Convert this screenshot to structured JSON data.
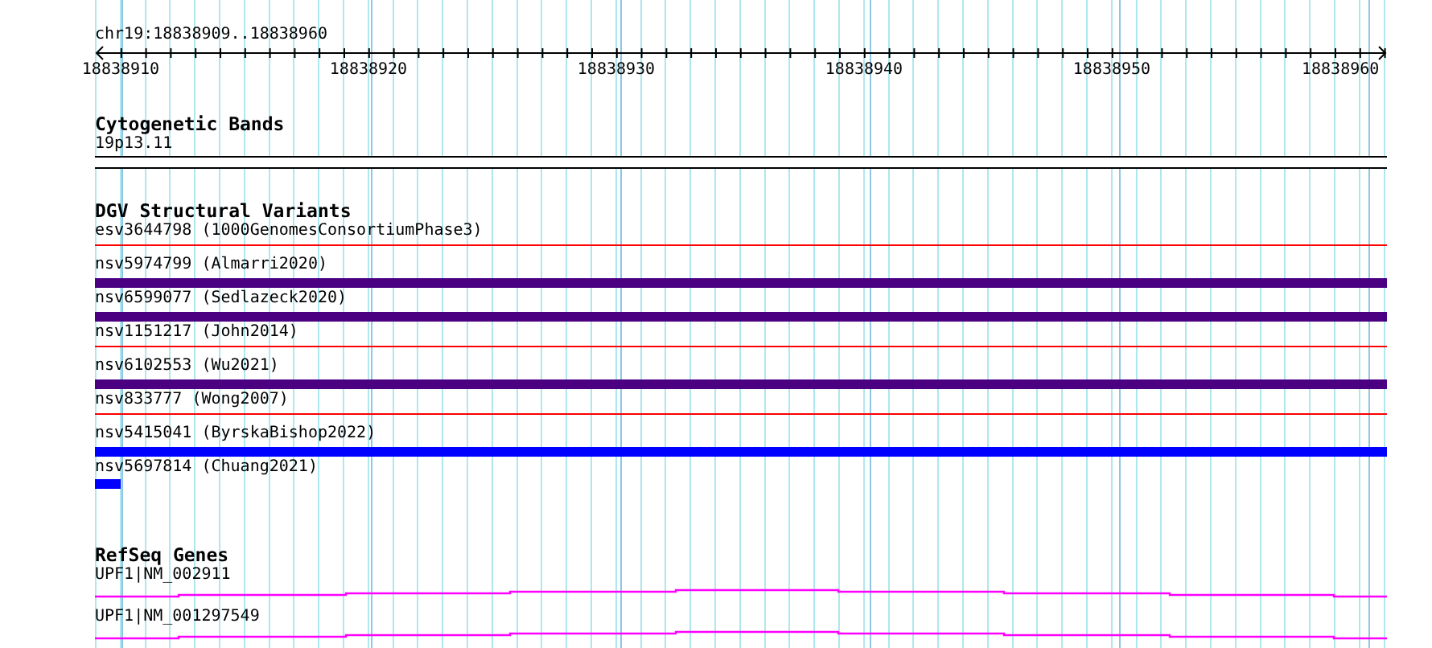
{
  "ruler": {
    "location": "chr19:18838909..18838960",
    "ticks": [
      "18838910",
      "18838920",
      "18838930",
      "18838940",
      "18838950",
      "18838960"
    ]
  },
  "tracks": [
    {
      "kind": "bands",
      "title": "Cytogenetic Bands",
      "features": [
        {
          "label": "19p13.11"
        }
      ]
    },
    {
      "kind": "variants",
      "title": "DGV Structural Variants",
      "features": [
        {
          "label": "esv3644798 (1000GenomesConsortiumPhase3)",
          "kind": "line",
          "color": "#ff0000"
        },
        {
          "label": "nsv5974799 (Almarri2020)",
          "kind": "bar",
          "color": "#4b0082"
        },
        {
          "label": "nsv6599077 (Sedlazeck2020)",
          "kind": "bar",
          "color": "#4b0082"
        },
        {
          "label": "nsv1151217 (John2014)",
          "kind": "line",
          "color": "#ff0000"
        },
        {
          "label": "nsv6102553 (Wu2021)",
          "kind": "bar",
          "color": "#4b0082"
        },
        {
          "label": "nsv833777 (Wong2007)",
          "kind": "line",
          "color": "#ff0000"
        },
        {
          "label": "nsv5415041 (ByrskaBishop2022)",
          "kind": "bar",
          "color": "#0000ff"
        },
        {
          "label": "nsv5697814 (Chuang2021)",
          "kind": "stub",
          "color": "#0000ff"
        }
      ]
    },
    {
      "kind": "genes",
      "title": "RefSeq Genes",
      "features": [
        {
          "label": "UPF1|NM_002911"
        },
        {
          "label": "UPF1|NM_001297549"
        }
      ]
    }
  ]
}
